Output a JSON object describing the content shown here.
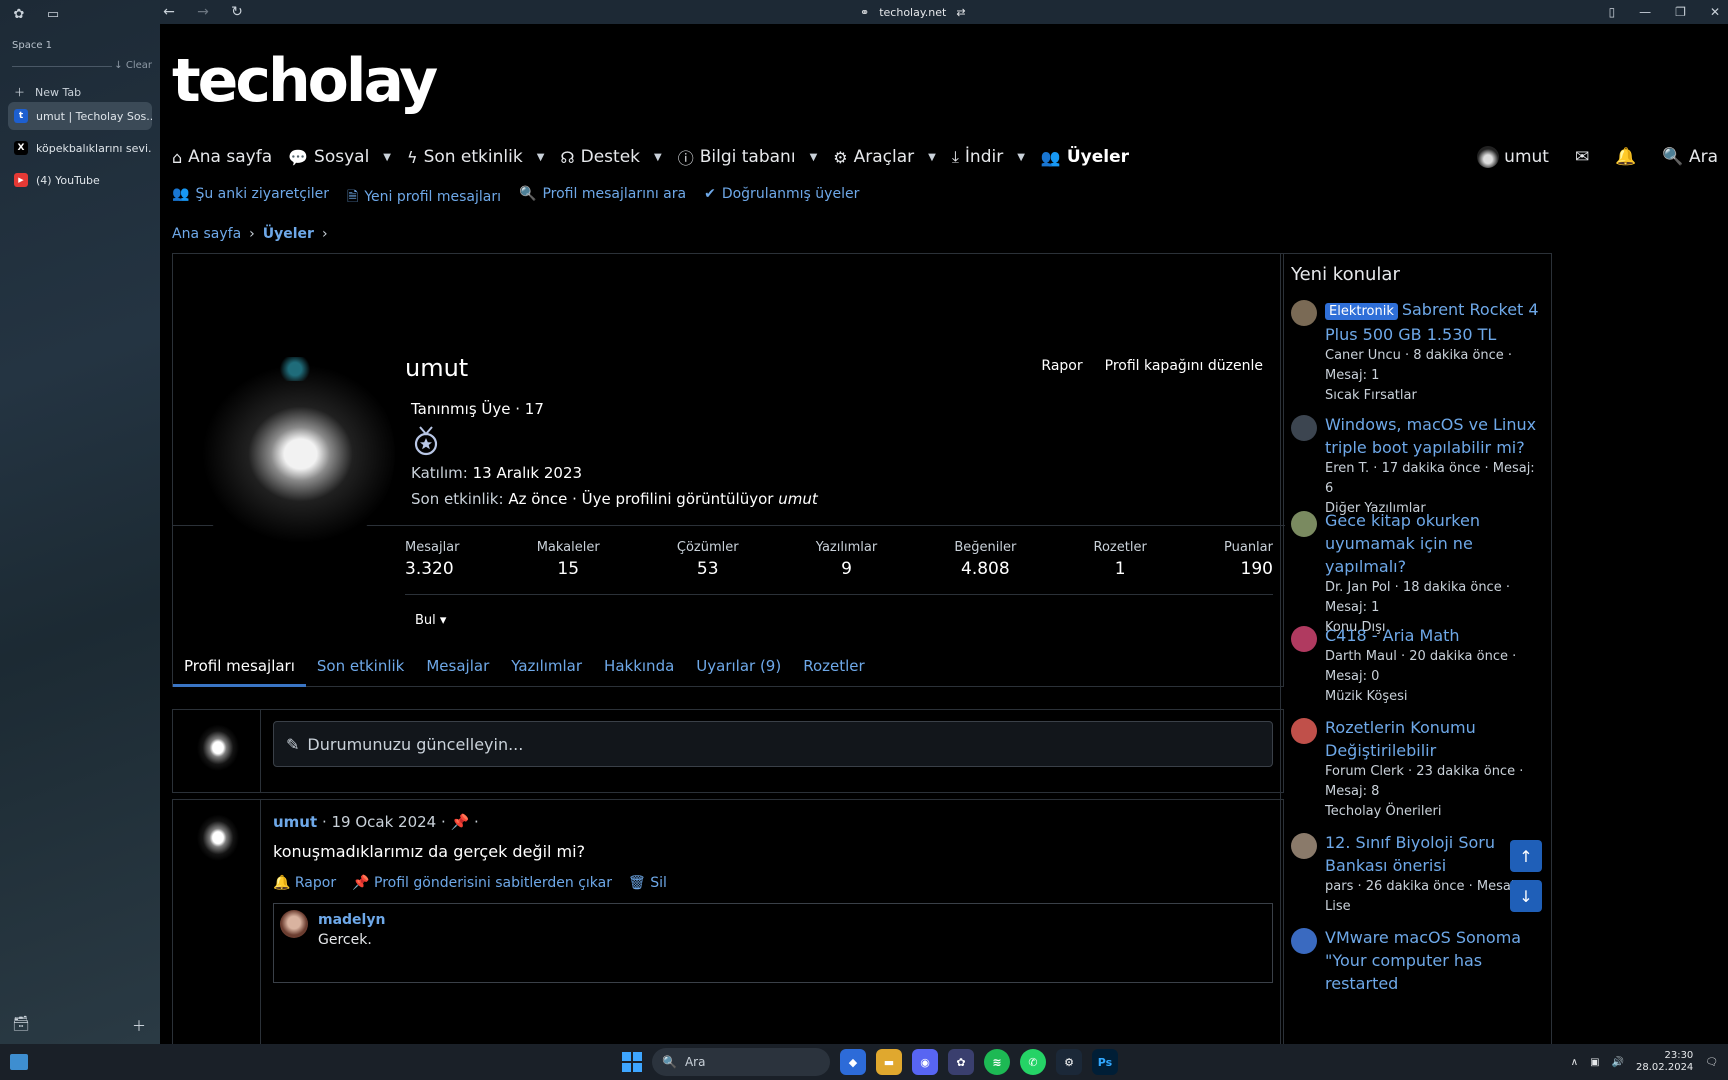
{
  "browser": {
    "space_label": "Space 1",
    "clear_label": "↓ Clear",
    "new_tab_label": "New Tab",
    "tabs": [
      {
        "label": "umut | Techolay Sos...",
        "favicon": "t",
        "color": "#1d5fd0"
      },
      {
        "label": "köpekbalıklarını sevi...",
        "favicon": "X",
        "color": "#000000"
      },
      {
        "label": "(4) YouTube",
        "favicon": "▶",
        "color": "#e53935"
      }
    ],
    "url": "techolay.net"
  },
  "site": {
    "logo": "techolay",
    "nav": [
      {
        "label": "Ana sayfa",
        "icon": "home-icon",
        "glyph": "⌂",
        "caret": false
      },
      {
        "label": "Sosyal",
        "icon": "chat-icon",
        "glyph": "💬",
        "caret": true
      },
      {
        "label": "Son etkinlik",
        "icon": "bolt-icon",
        "glyph": "ϟ",
        "caret": true
      },
      {
        "label": "Destek",
        "icon": "headset-icon",
        "glyph": "☊",
        "caret": true
      },
      {
        "label": "Bilgi tabanı",
        "icon": "info-icon",
        "glyph": "ⓘ",
        "caret": true
      },
      {
        "label": "Araçlar",
        "icon": "gear-icon",
        "glyph": "⚙",
        "caret": true
      },
      {
        "label": "İndir",
        "icon": "download-icon",
        "glyph": "⤓",
        "caret": true
      },
      {
        "label": "Üyeler",
        "icon": "users-icon",
        "glyph": "👥",
        "caret": false
      }
    ],
    "user_label": "umut",
    "search_label": "Ara",
    "subnav": [
      {
        "label": "Şu anki ziyaretçiler",
        "glyph": "👥"
      },
      {
        "label": "Yeni profil mesajları",
        "glyph": "🗎"
      },
      {
        "label": "Profil mesajlarını ara",
        "glyph": "🔍"
      },
      {
        "label": "Doğrulanmış üyeler",
        "glyph": "✔"
      }
    ],
    "breadcrumb": {
      "home": "Ana sayfa",
      "current": "Üyeler"
    }
  },
  "profile": {
    "name": "umut",
    "report": "Rapor",
    "edit_cover": "Profil kapağını düzenle",
    "title": "Tanınmış Üye · 17",
    "joined_label": "Katılım:",
    "joined_value": "13 Aralık 2023",
    "activity_label": "Son etkinlik:",
    "activity_value": "Az önce · Üye profilini görüntülüyor",
    "activity_user": "umut",
    "stats": [
      {
        "label": "Mesajlar",
        "value": "3.320"
      },
      {
        "label": "Makaleler",
        "value": "15"
      },
      {
        "label": "Çözümler",
        "value": "53"
      },
      {
        "label": "Yazılımlar",
        "value": "9"
      },
      {
        "label": "Beğeniler",
        "value": "4.808"
      },
      {
        "label": "Rozetler",
        "value": "1"
      },
      {
        "label": "Puanlar",
        "value": "190"
      }
    ],
    "find_label": "Bul ▾",
    "tabs": [
      "Profil mesajları",
      "Son etkinlik",
      "Mesajlar",
      "Yazılımlar",
      "Hakkında",
      "Uyarılar (9)",
      "Rozetler"
    ]
  },
  "status_placeholder": "Durumunuzu güncelleyin...",
  "post": {
    "user": "umut",
    "meta": "· 19 Ocak 2024 ·",
    "meta_end": "·",
    "body": "konuşmadıklarımız da gerçek değil mi?",
    "actions": [
      "Rapor",
      "Profil gönderisini sabitlerden çıkar",
      "Sil"
    ],
    "reply_user": "madelyn",
    "reply_text": "Gercek."
  },
  "widget": {
    "title": "Yeni konular",
    "items": [
      {
        "tag": "Elektronik",
        "title": "Sabrent Rocket 4 Plus 500 GB 1.530 TL",
        "meta": "Caner Uncu · 8 dakika önce · Mesaj: 1",
        "forum": "Sıcak Fırsatlar",
        "color": "#7a6a55"
      },
      {
        "tag": "",
        "title": "Windows, macOS ve Linux triple boot yapılabilir mi?",
        "meta": "Eren T. · 17 dakika önce · Mesaj: 6",
        "forum": "Diğer Yazılımlar",
        "color": "#3c4550"
      },
      {
        "tag": "",
        "title": "Gece kitap okurken uyumamak için ne yapılmalı?",
        "meta": "Dr. Jan Pol · 18 dakika önce · Mesaj: 1",
        "forum": "Konu Dışı",
        "color": "#7a8a60"
      },
      {
        "tag": "",
        "title": "C418 - Aria Math",
        "meta": "Darth Maul · 20 dakika önce · Mesaj: 0",
        "forum": "Müzik Köşesi",
        "color": "#b03a60"
      },
      {
        "tag": "",
        "title": "Rozetlerin Konumu Değiştirilebilir",
        "meta": "Forum Clerk · 23 dakika önce · Mesaj: 8",
        "forum": "Techolay Önerileri",
        "color": "#c0504a"
      },
      {
        "tag": "",
        "title": "12. Sınıf Biyoloji Soru Bankası önerisi",
        "meta": "pars · 26 dakika önce · Mesaj: 0",
        "forum": "Lise",
        "color": "#8a7a6a"
      },
      {
        "tag": "",
        "title": "VMware macOS Sonoma \"Your computer has restarted",
        "meta": "",
        "forum": "",
        "color": "#3a6ac0"
      }
    ]
  },
  "taskbar": {
    "search": "Ara",
    "time": "23:30",
    "date": "28.02.2024"
  }
}
